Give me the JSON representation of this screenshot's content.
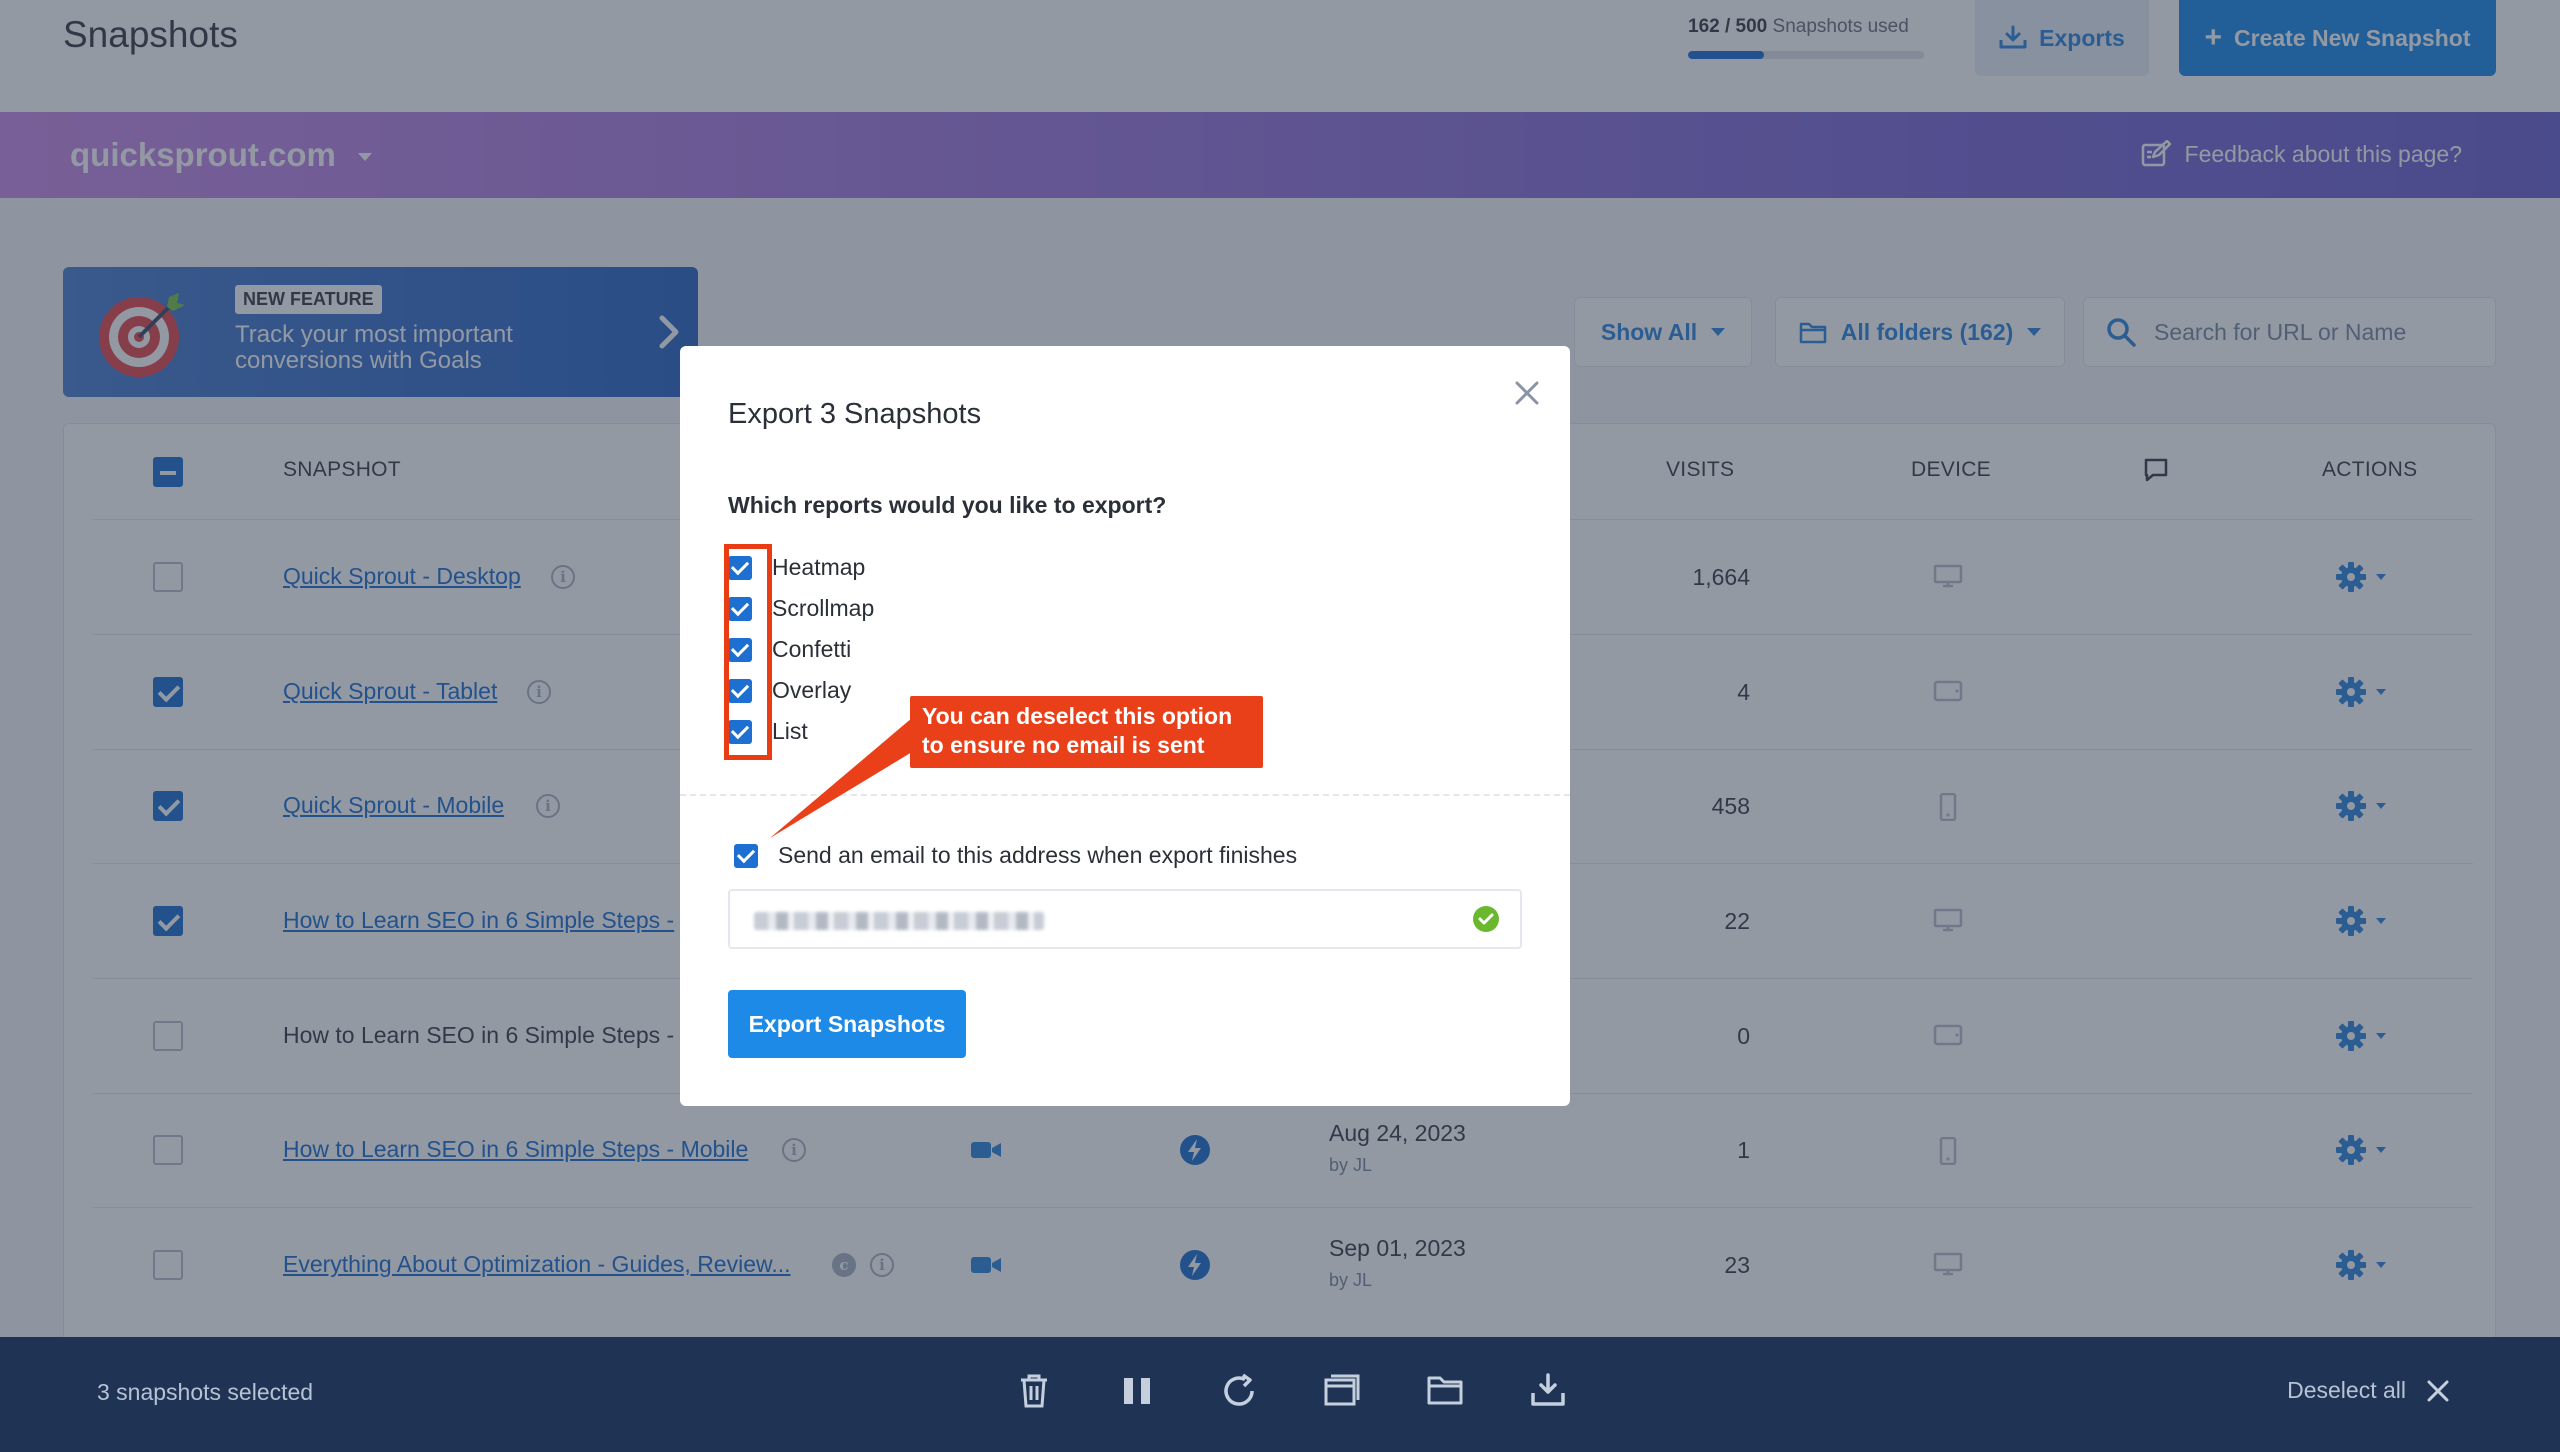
{
  "header": {
    "title": "Snapshots",
    "usage_used": "162 / 500",
    "usage_suffix": "Snapshots used",
    "usage_fraction": 0.324,
    "exports_label": "Exports",
    "create_label": "Create New Snapshot"
  },
  "site_bar": {
    "site": "quicksprout.com",
    "feedback": "Feedback about this page?"
  },
  "feature": {
    "badge": "NEW FEATURE",
    "text": "Track your most important conversions with Goals"
  },
  "filters": {
    "show": "Show All",
    "folders": "All folders (162)",
    "search_placeholder": "Search for URL or Name"
  },
  "table": {
    "headers": {
      "snapshot": "SNAPSHOT",
      "visits": "VISITS",
      "device": "DEVICE",
      "actions": "ACTIONS"
    },
    "rows": [
      {
        "name": "Quick Sprout - Desktop",
        "checked": false,
        "linked": true,
        "visits": "1,664",
        "device": "desktop",
        "date": "",
        "by": ""
      },
      {
        "name": "Quick Sprout - Tablet",
        "checked": true,
        "linked": true,
        "visits": "4",
        "device": "tablet",
        "date": "",
        "by": ""
      },
      {
        "name": "Quick Sprout - Mobile",
        "checked": true,
        "linked": true,
        "visits": "458",
        "device": "mobile",
        "date": "",
        "by": ""
      },
      {
        "name": "How to Learn SEO in 6 Simple Steps -",
        "checked": true,
        "linked": true,
        "visits": "22",
        "device": "desktop",
        "date": "",
        "by": ""
      },
      {
        "name": "How to Learn SEO in 6 Simple Steps -",
        "checked": false,
        "linked": false,
        "visits": "0",
        "device": "tablet",
        "date": "",
        "by": ""
      },
      {
        "name": "How to Learn SEO in 6 Simple Steps - Mobile",
        "checked": false,
        "linked": true,
        "visits": "1",
        "device": "mobile",
        "date": "Aug 24, 2023",
        "by": "by JL"
      },
      {
        "name": "Everything About Optimization - Guides, Review...",
        "checked": false,
        "linked": true,
        "visits": "23",
        "device": "desktop",
        "date": "Sep 01, 2023",
        "by": "by JL"
      }
    ]
  },
  "modal": {
    "title": "Export 3 Snapshots",
    "question": "Which reports would you like to export?",
    "options": [
      "Heatmap",
      "Scrollmap",
      "Confetti",
      "Overlay",
      "List"
    ],
    "email_label": "Send an email to this address when export finishes",
    "export_button": "Export Snapshots"
  },
  "callout": {
    "line1": "You can deselect this option",
    "line2": "to ensure no email is sent"
  },
  "bottom_bar": {
    "selected": "3 snapshots selected",
    "deselect": "Deselect all"
  },
  "colors": {
    "accent": "#1d8ae8",
    "link": "#1d6fd1",
    "annotation": "#ea4019",
    "bottom_bar": "#1f3454"
  }
}
